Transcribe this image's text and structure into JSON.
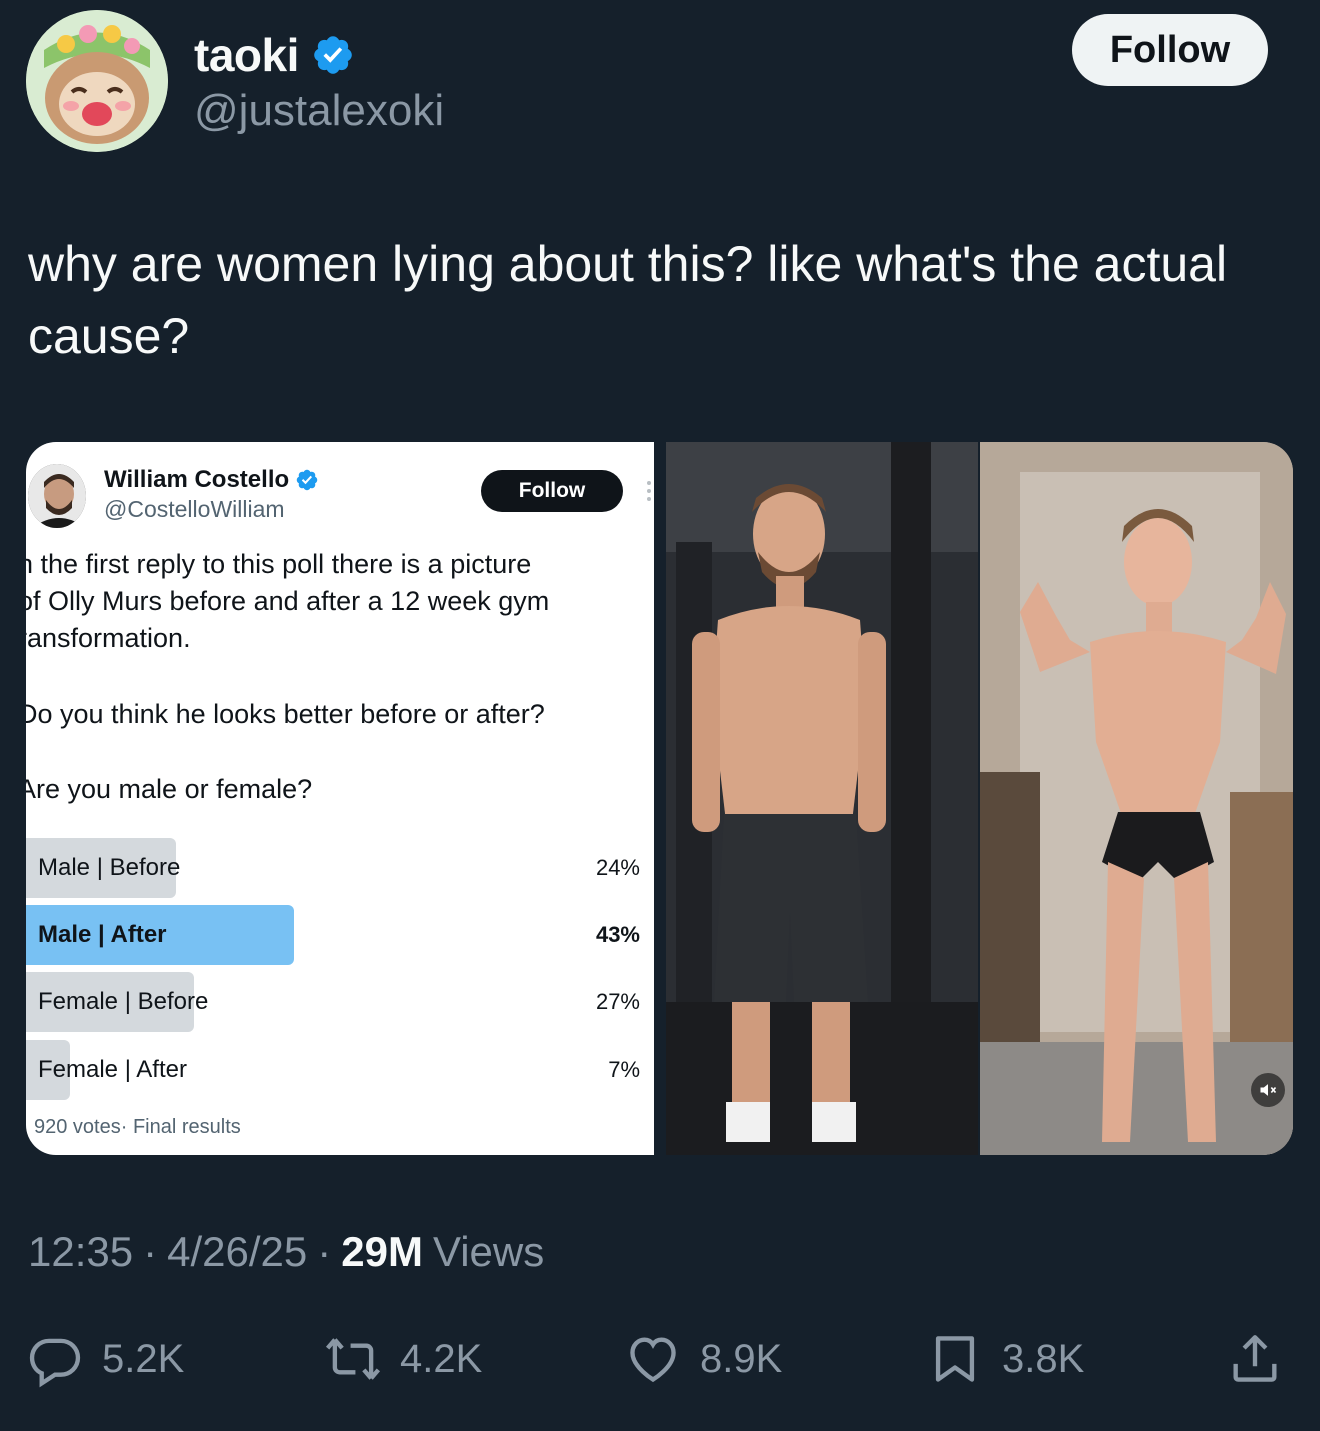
{
  "author": {
    "display_name": "taoki",
    "handle": "@justalexoki",
    "verified": true,
    "follow_label": "Follow"
  },
  "tweet": {
    "text": "why are women lying about this? like what's the actual cause?"
  },
  "embedded_screenshot": {
    "author_name": "William Costello",
    "author_handle": "@CostelloWilliam",
    "follow_label": "Follow",
    "text_lines": [
      "n the first reply to this poll there is a picture",
      "of Olly Murs before and after a 12 week gym",
      "ransformation.",
      "Do you think he looks better before or after?",
      "Are you male or female?"
    ],
    "poll": {
      "options": [
        {
          "label": "Male | Before",
          "percent_text": "24%",
          "percent": 24,
          "winner": false
        },
        {
          "label": "Male | After",
          "percent_text": "43%",
          "percent": 43,
          "winner": true
        },
        {
          "label": "Female | Before",
          "percent_text": "27%",
          "percent": 27,
          "winner": false
        },
        {
          "label": "Female | After",
          "percent_text": "7%",
          "percent": 7,
          "winner": false
        }
      ],
      "footer": "920 votes· Final results"
    }
  },
  "meta": {
    "time": "12:35",
    "sep1": "·",
    "date": "4/26/25",
    "sep2": "·",
    "views_count": "29M",
    "views_label": "Views"
  },
  "actions": {
    "replies": "5.2K",
    "reposts": "4.2K",
    "likes": "8.9K",
    "bookmarks": "3.8K"
  },
  "colors": {
    "background": "#15202b",
    "text_primary": "#f7f9f9",
    "text_secondary": "#8b98a5",
    "verified_blue": "#1d9bf0",
    "poll_winner": "#78c1f3",
    "poll_bar": "#d4d9dd"
  }
}
